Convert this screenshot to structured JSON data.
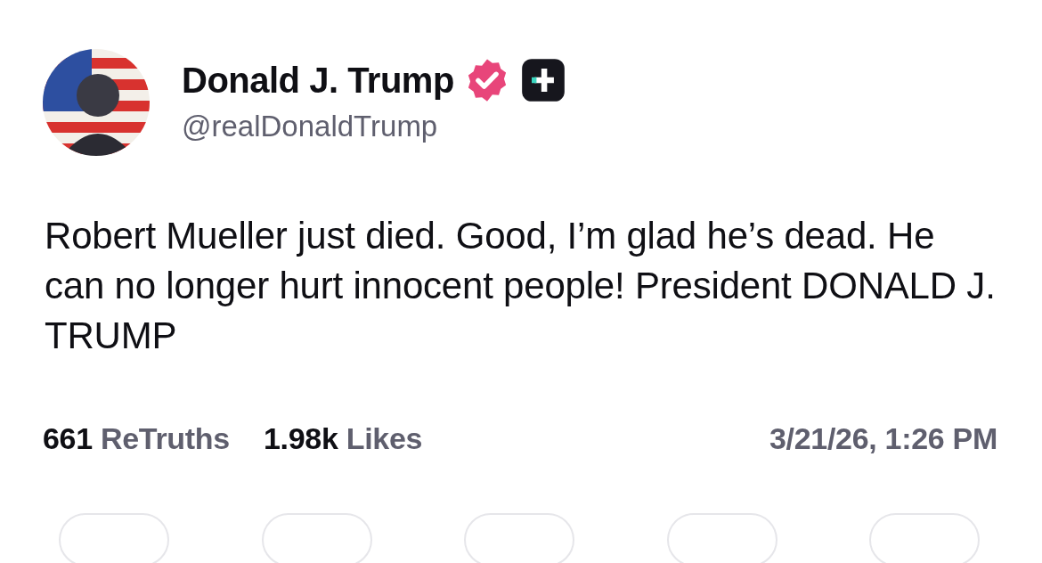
{
  "author": {
    "name": "Donald J. Trump",
    "handle": "@realDonaldTrump",
    "verified": true
  },
  "post": {
    "text": "Robert Mueller just died. Good, I’m glad he’s dead. He can no longer hurt innocent people! President DONALD J. TRUMP"
  },
  "stats": [
    {
      "count": "661",
      "label": "ReTruths"
    },
    {
      "count": "1.98k",
      "label": "Likes"
    }
  ],
  "timestamp": "3/21/26, 1:26 PM"
}
